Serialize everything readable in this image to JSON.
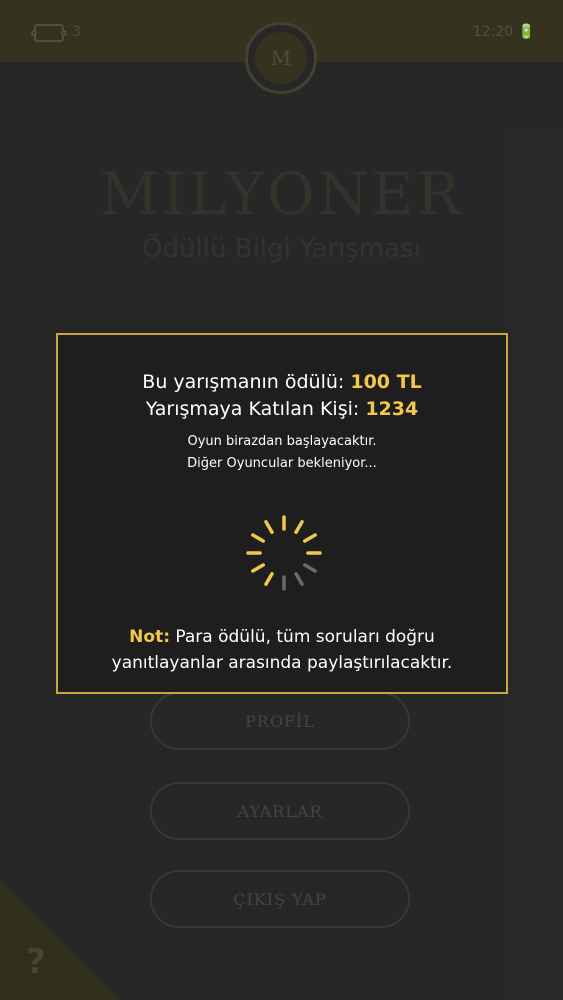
{
  "status_bar": {
    "ticket_count": "3",
    "time": "12:20"
  },
  "avatar": {
    "initial": "M"
  },
  "logo": {
    "title": "MILYONER",
    "subtitle": "Ödüllü Bilgi Yarışması"
  },
  "menu": {
    "profile_label": "PROFİL",
    "settings_label": "AYARLAR",
    "logout_label": "ÇIKIŞ YAP"
  },
  "help": {
    "label": "?"
  },
  "modal": {
    "prize_label": "Bu yarışmanın ödülü: ",
    "prize_value": "100 TL",
    "participants_label": "Yarışmaya Katılan Kişi: ",
    "participants_value": "1234",
    "starting_text": "Oyun birazdan başlayacaktır.",
    "waiting_text": "Diğer Oyuncular bekleniyor...",
    "note_label": "Not:",
    "note_text_1": " Para ödülü, tüm soruları doğru",
    "note_text_2": "yanıtlayanlar arasında paylaştırılacaktır."
  },
  "colors": {
    "accent": "#f3c84a",
    "modal_border": "#c9a43f",
    "spinner_active": "#f3c84a",
    "spinner_inactive": "#6a6a6a"
  },
  "icons": {
    "ticket": "ticket-icon",
    "battery": "battery-icon",
    "help": "question-icon",
    "spinner": "loading-spinner"
  }
}
